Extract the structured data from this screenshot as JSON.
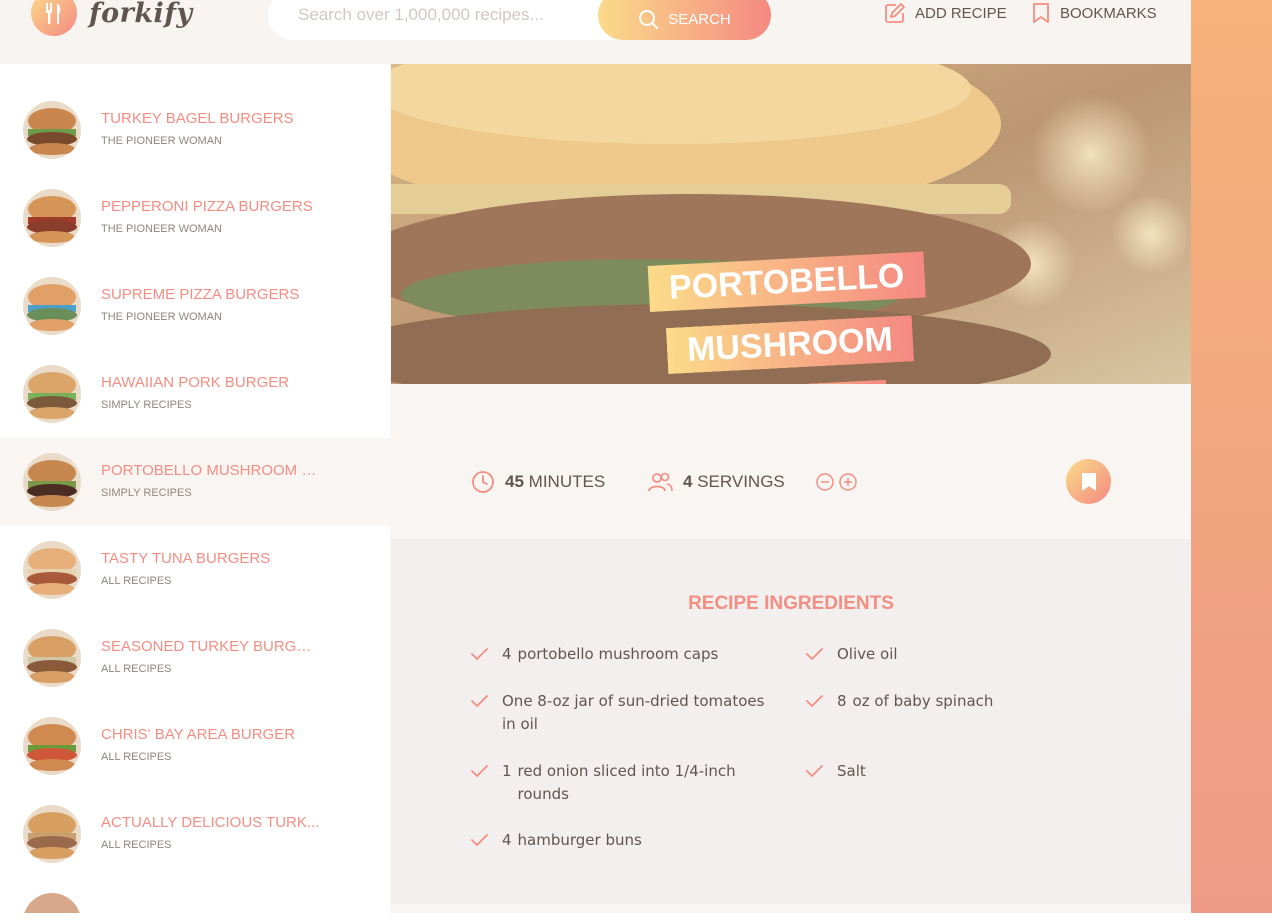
{
  "header": {
    "logo_text": "forkify",
    "search_placeholder": "Search over 1,000,000 recipes...",
    "search_button": "SEARCH",
    "add_recipe": "ADD RECIPE",
    "bookmarks": "BOOKMARKS"
  },
  "results": [
    {
      "title": "TURKEY BAGEL BURGERS",
      "publisher": "THE PIONEER WOMAN"
    },
    {
      "title": "PEPPERONI PIZZA BURGERS",
      "publisher": "THE PIONEER WOMAN"
    },
    {
      "title": "SUPREME PIZZA BURGERS",
      "publisher": "THE PIONEER WOMAN"
    },
    {
      "title": "HAWAIIAN PORK BURGER",
      "publisher": "SIMPLY RECIPES"
    },
    {
      "title": "PORTOBELLO MUSHROOM B...",
      "publisher": "SIMPLY RECIPES"
    },
    {
      "title": "TASTY TUNA BURGERS",
      "publisher": "ALL RECIPES"
    },
    {
      "title": "SEASONED TURKEY BURGERS",
      "publisher": "ALL RECIPES"
    },
    {
      "title": "CHRIS' BAY AREA BURGER",
      "publisher": "ALL RECIPES"
    },
    {
      "title": "ACTUALLY DELICIOUS TURK...",
      "publisher": "ALL RECIPES"
    }
  ],
  "recipe": {
    "title_line1": "PORTOBELLO",
    "title_line2": "MUSHROOM BURGER",
    "minutes": "45",
    "minutes_label": "MINUTES",
    "servings": "4",
    "servings_label": "SERVINGS"
  },
  "ingredients": {
    "heading": "RECIPE INGREDIENTS",
    "items": [
      {
        "qty": "4",
        "desc": "portobello mushroom caps"
      },
      {
        "qty": "",
        "desc": "One 8-oz jar of sun-dried tomatoes in oil"
      },
      {
        "qty": "1",
        "desc": "red onion sliced into 1/4-inch rounds"
      },
      {
        "qty": "4",
        "desc": "hamburger buns"
      },
      {
        "qty": "",
        "desc": "Olive oil"
      },
      {
        "qty": "8",
        "desc": "oz of baby spinach"
      },
      {
        "qty": "",
        "desc": "Salt"
      }
    ]
  },
  "colors": {
    "accent": "#f38e82",
    "gradient_start": "#fbdb89",
    "gradient_end": "#f48982",
    "text": "#615551"
  }
}
